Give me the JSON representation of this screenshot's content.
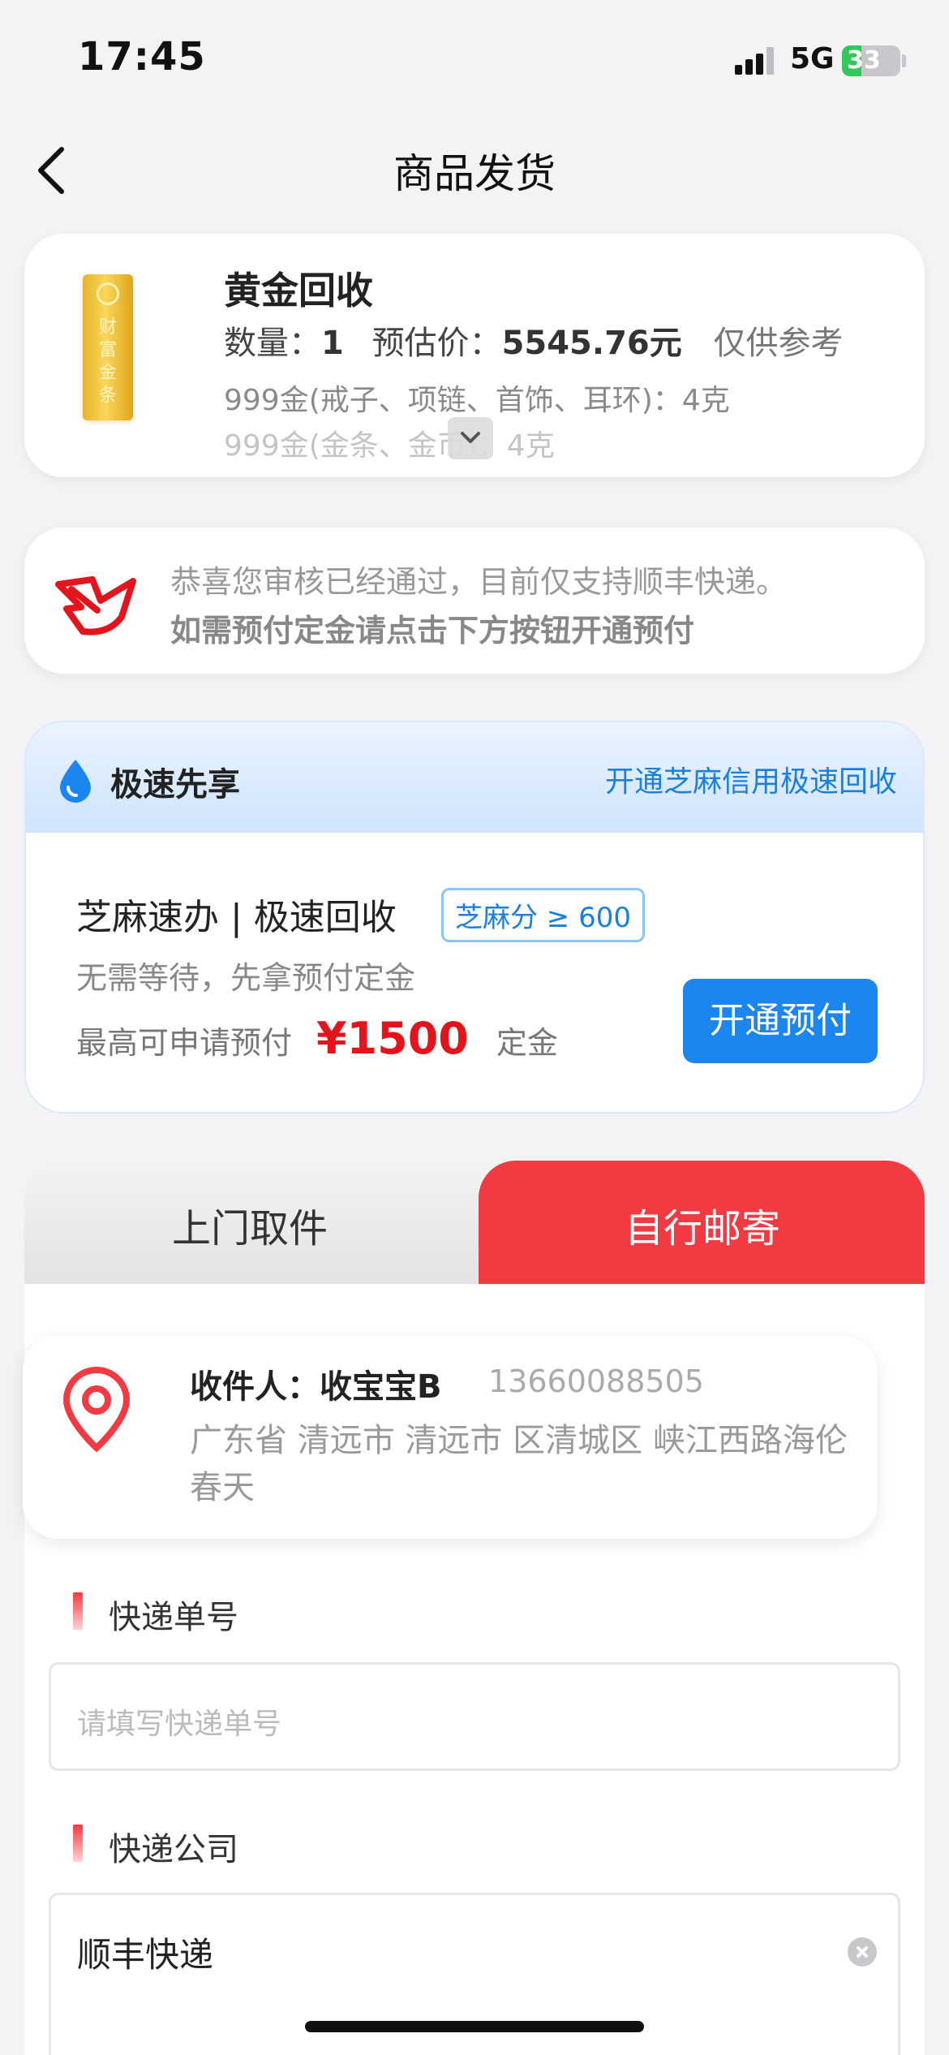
{
  "status_bar": {
    "time": "17:45",
    "network": "5G",
    "battery": "33",
    "battery_level": 0.33
  },
  "nav": {
    "title": "商品发货"
  },
  "product": {
    "title": "黄金回收",
    "qty_label": "数量：",
    "qty": "1",
    "price_label": "预估价：",
    "price": "5545.76元",
    "reference": "仅供参考",
    "bar_text": "财富金条",
    "spec_1": "999金(戒子、项链、首饰、耳环)：4克",
    "spec_2": "999金(金条、金币)：4克"
  },
  "notice": {
    "line1": "恭喜您审核已经通过，目前仅支持顺丰快递。",
    "line2": "如需预付定金请点击下方按钮开通预付"
  },
  "fast": {
    "title": "极速先享",
    "link": "开通芝麻信用极速回收",
    "subtitle": "芝麻速办 | 极速回收",
    "badge": "芝麻分 ≥ 600",
    "desc": "无需等待，先拿预付定金",
    "max_prefix": "最高可申请预付",
    "max_amount": "¥1500",
    "max_suffix": "定金",
    "button": "开通预付"
  },
  "tabs": {
    "left": "上门取件",
    "right": "自行邮寄",
    "active": "自行邮寄"
  },
  "address": {
    "name": "收件人：收宝宝B",
    "phone": "13660088505",
    "text": "广东省 清远市 清远市 区清城区 峡江西路海伦春天"
  },
  "tracking": {
    "label": "快递单号",
    "placeholder": "请填写快递单号"
  },
  "company": {
    "label": "快递公司",
    "value": "顺丰快递"
  },
  "colors": {
    "accent_red": "#f33a43",
    "accent_blue": "#1b85f0",
    "amount_red": "#e4141c"
  }
}
